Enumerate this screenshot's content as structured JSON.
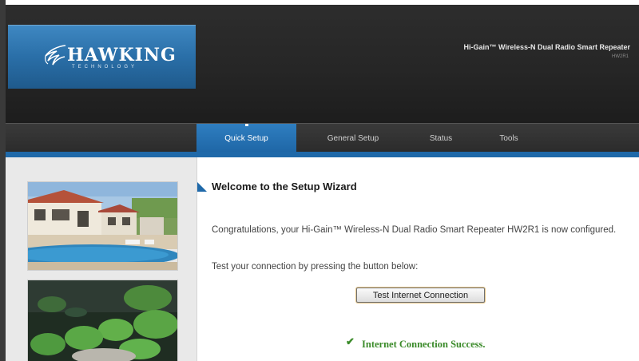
{
  "brand": {
    "logo_text": "HAWKING",
    "logo_sub": "TECHNOLOGY"
  },
  "header": {
    "product_title": "Hi-Gain™ Wireless-N Dual Radio Smart Repeater",
    "product_model": "HW2R1"
  },
  "nav": {
    "tabs": [
      {
        "label": "Quick Setup",
        "active": true
      },
      {
        "label": "General Setup",
        "active": false
      },
      {
        "label": "Status",
        "active": false
      },
      {
        "label": "Tools",
        "active": false
      }
    ]
  },
  "wizard": {
    "title": "Welcome to the Setup Wizard",
    "congrats": "Congratulations, your Hi-Gain™ Wireless-N Dual Radio Smart Repeater HW2R1 is now configured.",
    "test_hint": "Test your connection by pressing the button below:",
    "test_button_label": "Test Internet Connection",
    "success_message": "Internet Connection Success."
  },
  "colors": {
    "accent": "#1f69a9",
    "success": "#3b8b2a"
  },
  "icons": {
    "check": "check-icon",
    "arrow": "triangle-arrow-icon"
  }
}
